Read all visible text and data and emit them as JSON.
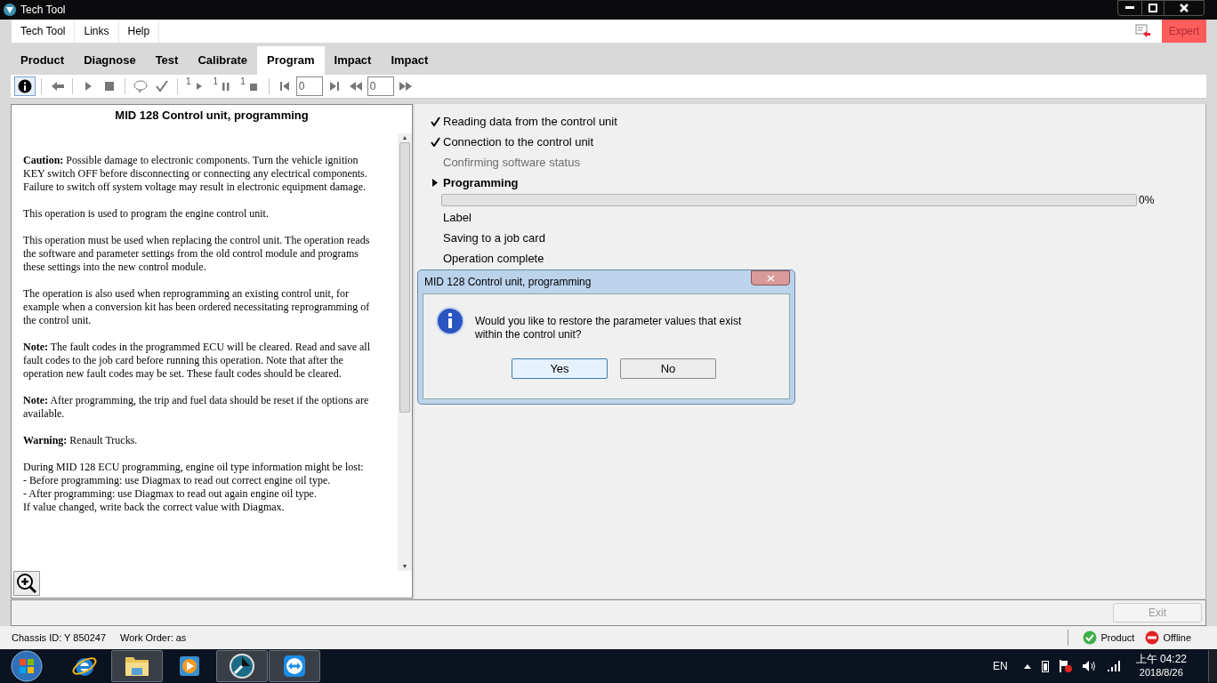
{
  "window": {
    "title": "Tech Tool"
  },
  "menu": [
    "Tech Tool",
    "Links",
    "Help"
  ],
  "mode_button": {
    "label": "Expert"
  },
  "tabs": [
    {
      "label": "Product",
      "selected": false
    },
    {
      "label": "Diagnose",
      "selected": false
    },
    {
      "label": "Test",
      "selected": false
    },
    {
      "label": "Calibrate",
      "selected": false
    },
    {
      "label": "Program",
      "selected": true
    },
    {
      "label": "Impact",
      "selected": false
    },
    {
      "label": "Impact",
      "selected": false
    }
  ],
  "toolbar": [
    {
      "kind": "info",
      "selected": true
    },
    {
      "kind": "sep"
    },
    {
      "kind": "back"
    },
    {
      "kind": "sep"
    },
    {
      "kind": "play"
    },
    {
      "kind": "stop"
    },
    {
      "kind": "sep"
    },
    {
      "kind": "balloon"
    },
    {
      "kind": "check"
    },
    {
      "kind": "sep"
    },
    {
      "kind": "step-play",
      "label": "1"
    },
    {
      "kind": "step-pause",
      "label": "1"
    },
    {
      "kind": "step-stop",
      "label": "1"
    },
    {
      "kind": "sep"
    },
    {
      "kind": "first"
    },
    {
      "kind": "field",
      "value": "0"
    },
    {
      "kind": "last"
    },
    {
      "kind": "rewind"
    },
    {
      "kind": "field",
      "value": "0"
    },
    {
      "kind": "forward"
    }
  ],
  "document": {
    "title": "MID 128 Control unit, programming",
    "paragraphs": [
      [
        "**Caution:** Possible damage to electronic components. Turn the vehicle ignition KEY switch OFF before disconnecting or connecting any electrical components. Failure to switch off system voltage may result in electronic equipment damage."
      ],
      [
        "This operation is used to program the engine control unit."
      ],
      [
        "This operation must be used when replacing the control unit. The operation reads the software and parameter settings from the old control module and programs these settings into the new control module."
      ],
      [
        "The operation is also used when reprogramming an existing control unit, for example when a conversion kit has been ordered necessitating reprogramming of the control unit."
      ],
      [
        "**Note:** The fault codes in the programmed ECU will be cleared. Read and save all fault codes to the job card before running this operation. Note that after the operation new fault codes may be set. These fault codes should be cleared."
      ],
      [
        "**Note:** After programming, the trip and fuel data should be reset if the options are available."
      ],
      [
        "**Warning:** Renault Trucks."
      ],
      [
        "During MID 128 ECU programming, engine oil type information might be lost:",
        "- Before programming: use Diagmax to read out correct engine oil type.",
        "- After programming: use Diagmax to read out again engine oil type.",
        "If value changed, write back the correct value with Diagmax."
      ]
    ]
  },
  "scrollbar": {
    "up": "▲",
    "down": "▼"
  },
  "steps": [
    {
      "label": "Reading data from the control unit",
      "kind": "done"
    },
    {
      "label": "Connection to the control unit",
      "kind": "done"
    },
    {
      "label": "Confirming software status",
      "kind": "skipped"
    },
    {
      "label": "Programming",
      "kind": "current",
      "level": 0,
      "reading": "0%"
    },
    {
      "label": "Label",
      "kind": "pending"
    },
    {
      "label": "Saving to a job card",
      "kind": "pending"
    },
    {
      "label": "Operation complete",
      "kind": "pending"
    }
  ],
  "dialog": {
    "title": "MID 128 Control unit, programming",
    "message": "Would you like to restore the parameter values that exist within the control unit?",
    "buttons": [
      {
        "label": "Yes",
        "selected": true
      },
      {
        "label": "No",
        "selected": false
      }
    ]
  },
  "exit_button": {
    "label": "Exit",
    "disabled": true
  },
  "status_bar": {
    "left": [
      "Chassis ID: Y 850247",
      "Work Order: as"
    ],
    "indicators": [
      {
        "label": "Product",
        "kind": "ok"
      },
      {
        "label": "Offline",
        "kind": "error"
      }
    ]
  },
  "taskbar": {
    "apps": [
      {
        "kind": "ie",
        "selected": false
      },
      {
        "kind": "folder",
        "selected": true
      },
      {
        "kind": "media",
        "selected": false
      },
      {
        "kind": "techtool",
        "selected": true
      },
      {
        "kind": "remote",
        "selected": true
      }
    ],
    "language": "EN",
    "time": "上午 04:22",
    "date": "2018/8/26"
  }
}
